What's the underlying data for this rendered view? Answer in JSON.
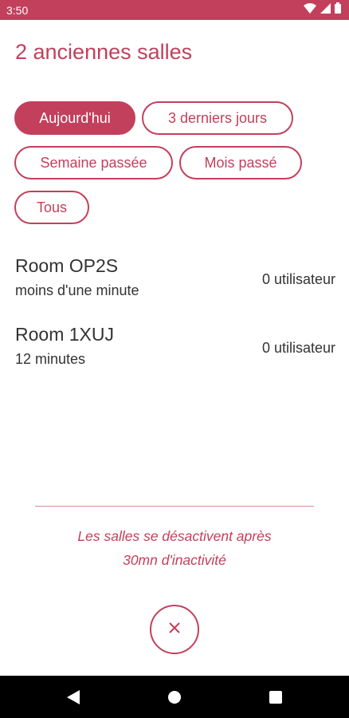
{
  "status_bar": {
    "time": "3:50",
    "icons": [
      "wifi-icon",
      "signal-icon",
      "battery-icon"
    ]
  },
  "header": {
    "title": "2 anciennes salles"
  },
  "filters": [
    {
      "label": "Aujourd'hui",
      "active": true
    },
    {
      "label": "3 derniers jours",
      "active": false
    },
    {
      "label": "Semaine passée",
      "active": false
    },
    {
      "label": "Mois passé",
      "active": false
    },
    {
      "label": "Tous",
      "active": false
    }
  ],
  "rooms": [
    {
      "name": "Room OP2S",
      "age": "moins d'une minute",
      "users": "0 utilisateur"
    },
    {
      "name": "Room 1XUJ",
      "age": "12 minutes",
      "users": "0 utilisateur"
    }
  ],
  "info": {
    "line1": "Les salles se désactivent après",
    "line2": "30mn d'inactivité"
  },
  "close": {
    "icon": "close-icon"
  },
  "nav": {
    "icons": [
      "back-icon",
      "home-icon",
      "recents-icon"
    ]
  },
  "colors": {
    "accent": "#c2405c",
    "text": "#333333",
    "navbar": "#000000"
  }
}
